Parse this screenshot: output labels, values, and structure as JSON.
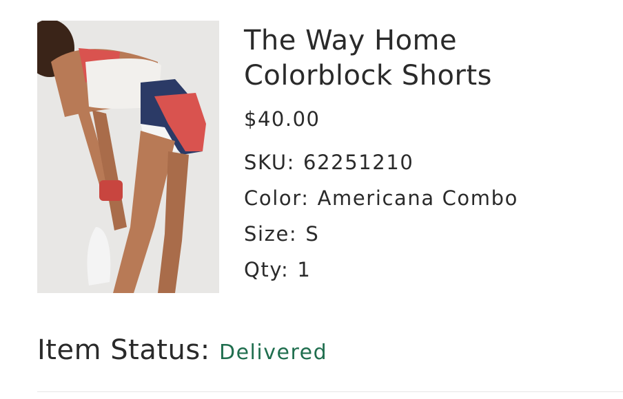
{
  "product": {
    "title_line1": "The Way Home",
    "title_line2": "Colorblock Shorts",
    "price": "$40.00",
    "sku_label": "SKU:",
    "sku_value": "62251210",
    "color_label": "Color:",
    "color_value": "Americana Combo",
    "size_label": "Size:",
    "size_value": "S",
    "qty_label": "Qty:",
    "qty_value": "1",
    "image_alt": "The Way Home Colorblock Shorts"
  },
  "status": {
    "label": "Item Status:",
    "value": "Delivered"
  },
  "colors": {
    "status_green": "#1f6e4e",
    "text": "#2a2a2a"
  }
}
